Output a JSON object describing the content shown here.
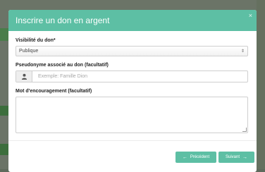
{
  "modal": {
    "title": "Inscrire un don en argent",
    "close_label": "×"
  },
  "form": {
    "visibility": {
      "label": "Visibilité du don*",
      "selected": "Publique",
      "arrows": "⇕"
    },
    "pseudonym": {
      "label": "Pseudonyme associé au don (facultatif)",
      "placeholder": "Exemple: Famille Dion"
    },
    "encouragement": {
      "label": "Mot d'encouragement (facultatif)"
    }
  },
  "footer": {
    "prev_label": "Précédent",
    "prev_arrow": "←",
    "next_label": "Suivant",
    "next_arrow": "→"
  },
  "colors": {
    "accent": "#5dbfa4"
  }
}
